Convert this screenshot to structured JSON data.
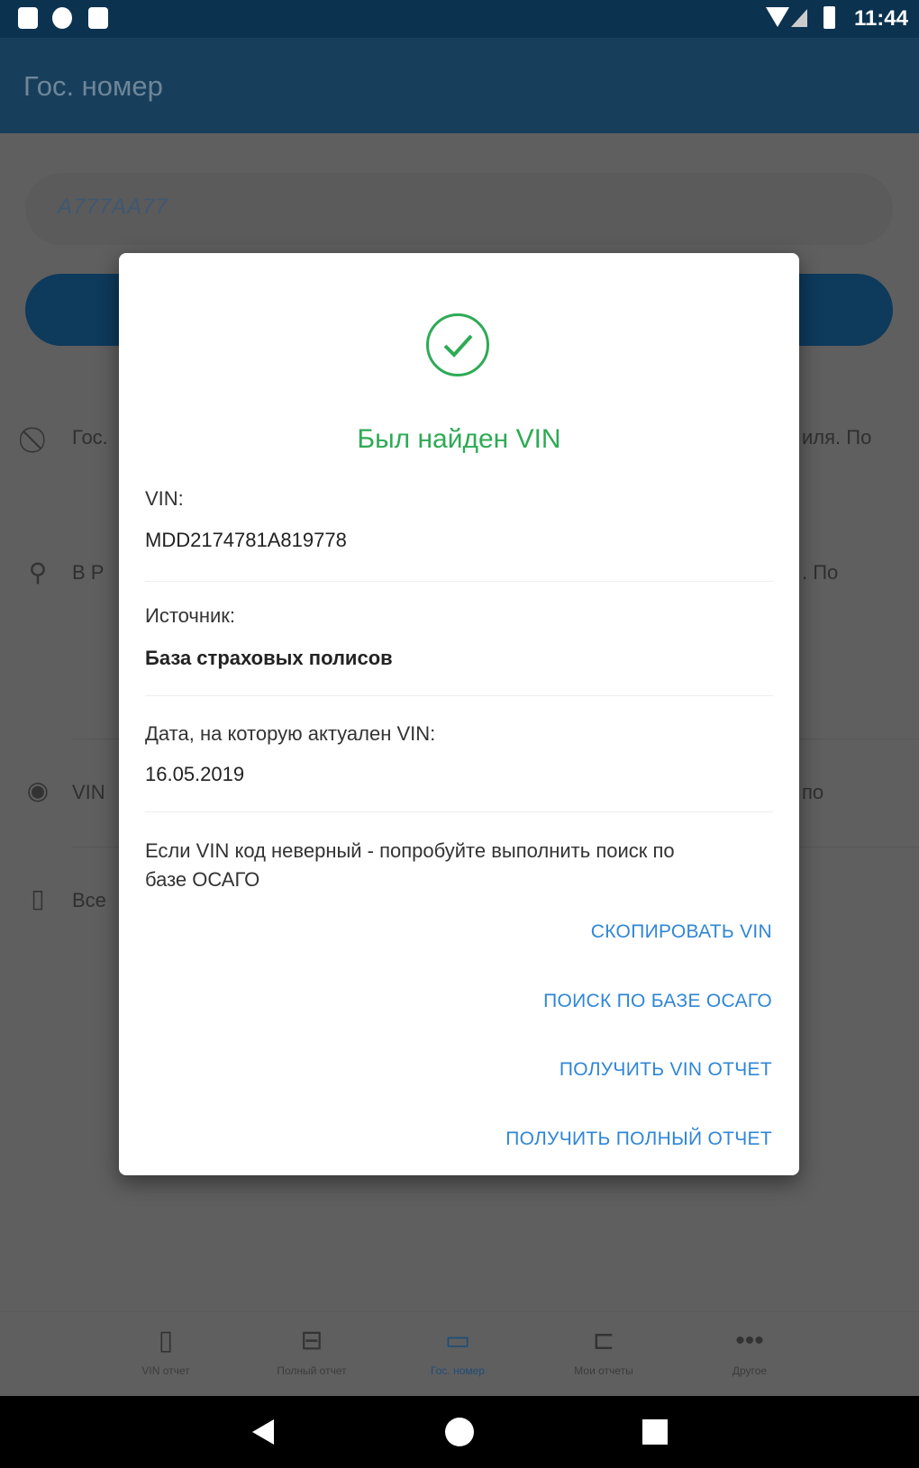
{
  "status_bar": {
    "time": "11:44",
    "icons": [
      "notification-icon",
      "settings-icon",
      "sd-card-icon",
      "wifi-icon",
      "signal-icon",
      "battery-icon"
    ]
  },
  "app_bar": {
    "title": "Гос. номер"
  },
  "plate_input": {
    "placeholder": "A777AA77"
  },
  "background_rows": [
    {
      "icon": "block-icon",
      "left_text": "Гос.",
      "right_text": "иля. По"
    },
    {
      "icon": "search-icon",
      "left_text": "В Р",
      "right_text": ". По"
    },
    {
      "icon": "eye-icon",
      "left_text": "VIN",
      "right_text": "по"
    },
    {
      "icon": "document-icon",
      "left_text": "Все",
      "right_text": ""
    }
  ],
  "bottom_nav": [
    {
      "label": "VIN отчет",
      "icon": "document-icon"
    },
    {
      "label": "Полный отчет",
      "icon": "briefcase-icon"
    },
    {
      "label": "Гос. номер",
      "icon": "plate-icon",
      "active": true
    },
    {
      "label": "Мои отчеты",
      "icon": "folder-icon"
    },
    {
      "label": "Другое",
      "icon": "more-icon"
    }
  ],
  "dialog": {
    "title": "Был найден VIN",
    "vin_label": "VIN:",
    "vin_value": "MDD2174781A819778",
    "source_label": "Источник:",
    "source_value": "База страховых полисов",
    "date_label": "Дата, на которую актуален VIN:",
    "date_value": "16.05.2019",
    "note": "Если VIN код неверный - попробуйте выполнить поиск по базе ОСАГО",
    "actions": [
      "Скопировать VIN",
      "Поиск по базе ОСАГО",
      "Получить VIN отчет",
      "Получить полный отчет"
    ]
  },
  "colors": {
    "success": "#2eaa55",
    "link": "#2f86d6",
    "primary": "#173f5c"
  }
}
